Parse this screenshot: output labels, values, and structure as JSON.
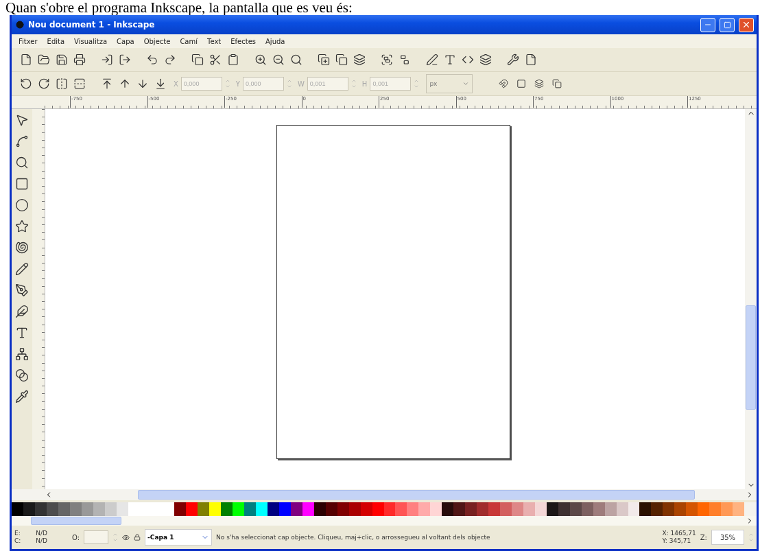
{
  "caption": "Quan s'obre el programa Inkscape, la pantalla que es veu és:",
  "window": {
    "title": "Nou document 1 - Inkscape"
  },
  "menu": [
    "Fitxer",
    "Edita",
    "Visualitza",
    "Capa",
    "Objecte",
    "Camí",
    "Text",
    "Efectes",
    "Ajuda"
  ],
  "coords_toolbar": {
    "disabled": true,
    "fields": [
      {
        "label": "X",
        "value": "0,000"
      },
      {
        "label": "Y",
        "value": "0,000"
      },
      {
        "label": "W",
        "value": "0,001"
      },
      {
        "label": "H",
        "value": "0,001"
      }
    ],
    "unit": "px"
  },
  "ruler": {
    "labels": [
      "-750",
      "-500",
      "-250",
      "0",
      "250",
      "500",
      "750",
      "1000",
      "1250"
    ]
  },
  "status_bar": {
    "fill_label": "E:",
    "fill": "N/D",
    "stroke_label": "C:",
    "stroke": "N/D",
    "opacity_label": "O:",
    "layer": "-Capa 1",
    "message": "No s'ha seleccionat cap objecte. Cliqueu, maj+clic, o arrossegueu al voltant dels objecte",
    "x": "X: 1465,71",
    "y": "Y: 345,71",
    "zoom_label": "Z:",
    "zoom": "35%"
  }
}
